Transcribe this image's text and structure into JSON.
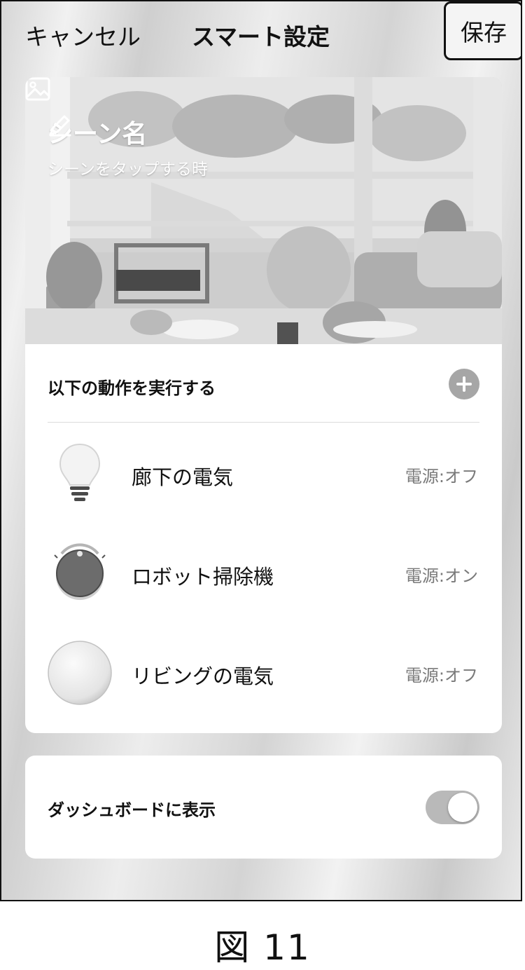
{
  "header": {
    "cancel_label": "キャンセル",
    "title": "スマート設定",
    "save_label": "保存"
  },
  "scene": {
    "name": "シーン名",
    "trigger": "シーンをタップする時"
  },
  "actions": {
    "heading": "以下の動作を実行する",
    "items": [
      {
        "name": "廊下の電気",
        "state": "電源:オフ",
        "icon": "light-bulb-icon"
      },
      {
        "name": "ロボット掃除機",
        "state": "電源:オン",
        "icon": "robot-vacuum-icon"
      },
      {
        "name": "リビングの電気",
        "state": "電源:オフ",
        "icon": "ceiling-light-icon"
      }
    ]
  },
  "dashboard": {
    "label": "ダッシュボードに表示",
    "enabled": true
  },
  "figure_caption": "図 11"
}
